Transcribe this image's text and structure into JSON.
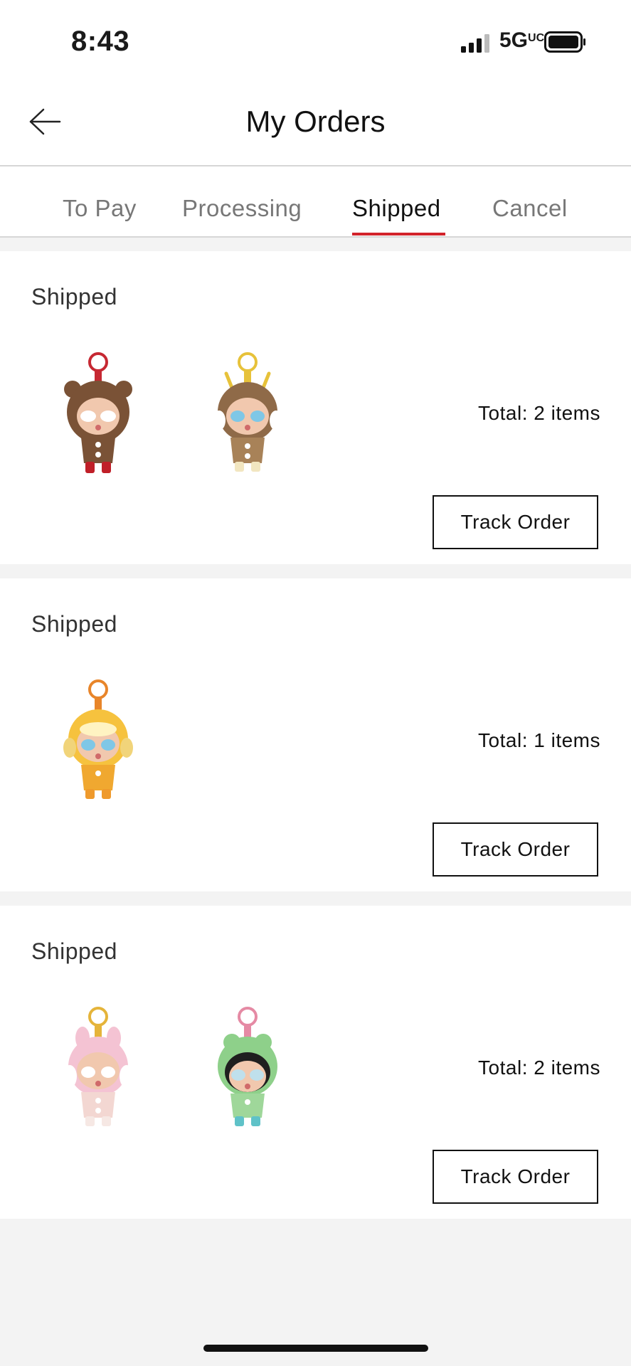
{
  "status_bar": {
    "time": "8:43",
    "network": "5G",
    "network_sup": "UC"
  },
  "header": {
    "title": "My Orders",
    "back_icon": "arrow-left-icon"
  },
  "tabs": [
    {
      "label": "To Pay",
      "active": false
    },
    {
      "label": "Processing",
      "active": false
    },
    {
      "label": "Shipped",
      "active": true
    },
    {
      "label": "Cancel",
      "active": false
    }
  ],
  "accent_color": "#d2232a",
  "orders": [
    {
      "status": "Shipped",
      "total": "Total: 2 items",
      "track_label": "Track Order",
      "items": [
        {
          "icon": "brown-bear-hood-doll-keychain"
        },
        {
          "icon": "bee-antenna-hood-doll-keychain"
        }
      ]
    },
    {
      "status": "Shipped",
      "total": "Total: 1 items",
      "track_label": "Track Order",
      "items": [
        {
          "icon": "yellow-chick-hood-doll-keychain"
        }
      ]
    },
    {
      "status": "Shipped",
      "total": "Total: 2 items",
      "track_label": "Track Order",
      "items": [
        {
          "icon": "pink-bunny-hood-doll-keychain"
        },
        {
          "icon": "green-frog-hood-doll-keychain"
        }
      ]
    }
  ]
}
